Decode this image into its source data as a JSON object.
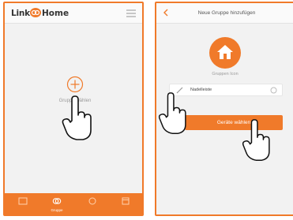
{
  "left_screen": {
    "brand": {
      "pre": "Link",
      "post": "Home"
    },
    "add_group_label": "Gruppe wählen",
    "tabs": [
      {
        "icon": "devices-icon",
        "label": "",
        "active": false
      },
      {
        "icon": "groups-icon",
        "label": "Gruppe",
        "active": true
      },
      {
        "icon": "scenes-icon",
        "label": "",
        "active": false
      },
      {
        "icon": "schedule-icon",
        "label": "",
        "active": false
      }
    ]
  },
  "right_screen": {
    "title": "Neue Gruppe hinzufügen",
    "icon_label": "Gruppen Icon",
    "name_field": {
      "value": "Nadelleiste"
    },
    "select_button_label": "Geräte wählen"
  },
  "colors": {
    "accent": "#f07a2a",
    "background": "#f2f2f2"
  }
}
